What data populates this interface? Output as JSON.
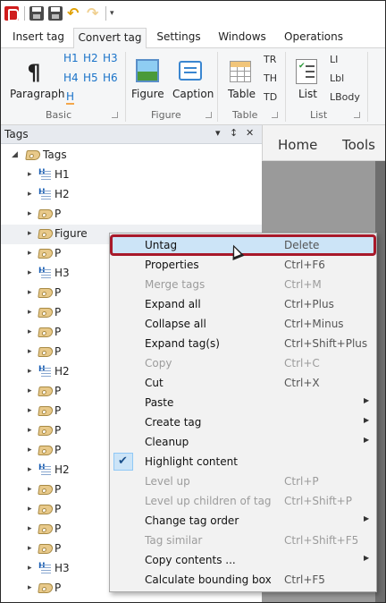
{
  "tabs": [
    "Insert tag",
    "Convert tag",
    "Settings",
    "Windows",
    "Operations"
  ],
  "active_tab": "Convert tag",
  "ribbon": {
    "groups": {
      "basic": "Basic",
      "figure": "Figure",
      "table": "Table",
      "list": "List"
    },
    "paragraph_label": "Paragraph",
    "headings": [
      "H1",
      "H2",
      "H3",
      "H4",
      "H5",
      "H6",
      "H"
    ],
    "figure_label": "Figure",
    "caption_label": "Caption",
    "table_label": "Table",
    "table_small": [
      "TR",
      "TH",
      "TD"
    ],
    "list_label": "List",
    "list_small": [
      "LI",
      "Lbl",
      "LBody"
    ]
  },
  "tags_panel": {
    "title": "Tags",
    "pin": "▾",
    "pin2": "↕",
    "close": "✕",
    "root": "Tags",
    "nodes": [
      {
        "label": "H1",
        "kind": "heading"
      },
      {
        "label": "H2",
        "kind": "heading"
      },
      {
        "label": "P",
        "kind": "tag"
      },
      {
        "label": "Figure",
        "kind": "tag"
      },
      {
        "label": "P",
        "kind": "tag"
      },
      {
        "label": "H3",
        "kind": "heading"
      },
      {
        "label": "P",
        "kind": "tag"
      },
      {
        "label": "P",
        "kind": "tag"
      },
      {
        "label": "P",
        "kind": "tag"
      },
      {
        "label": "P",
        "kind": "tag"
      },
      {
        "label": "H2",
        "kind": "heading"
      },
      {
        "label": "P",
        "kind": "tag"
      },
      {
        "label": "P",
        "kind": "tag"
      },
      {
        "label": "P",
        "kind": "tag"
      },
      {
        "label": "P",
        "kind": "tag"
      },
      {
        "label": "H2",
        "kind": "heading"
      },
      {
        "label": "P",
        "kind": "tag"
      },
      {
        "label": "P",
        "kind": "tag"
      },
      {
        "label": "P",
        "kind": "tag"
      },
      {
        "label": "P",
        "kind": "tag"
      },
      {
        "label": "H3",
        "kind": "heading"
      },
      {
        "label": "P",
        "kind": "tag"
      }
    ]
  },
  "document_tabs": [
    "Home",
    "Tools"
  ],
  "context_menu": [
    {
      "label": "Untag",
      "shortcut": "Delete",
      "state": "highlight"
    },
    {
      "label": "Properties",
      "shortcut": "Ctrl+F6"
    },
    {
      "label": "Merge tags",
      "shortcut": "Ctrl+M",
      "disabled": true
    },
    {
      "label": "Expand all",
      "shortcut": "Ctrl+Plus"
    },
    {
      "label": "Collapse all",
      "shortcut": "Ctrl+Minus"
    },
    {
      "label": "Expand tag(s)",
      "shortcut": "Ctrl+Shift+Plus"
    },
    {
      "label": "Copy",
      "shortcut": "Ctrl+C",
      "disabled": true
    },
    {
      "label": "Cut",
      "shortcut": "Ctrl+X"
    },
    {
      "label": "Paste",
      "shortcut": "",
      "submenu": true
    },
    {
      "label": "Create tag",
      "shortcut": "",
      "submenu": true
    },
    {
      "label": "Cleanup",
      "shortcut": "",
      "submenu": true
    },
    {
      "label": "Highlight content",
      "shortcut": "",
      "checked": true
    },
    {
      "label": "Level up",
      "shortcut": "Ctrl+P",
      "disabled": true
    },
    {
      "label": "Level up children of tag",
      "shortcut": "Ctrl+Shift+P",
      "disabled": true
    },
    {
      "label": "Change tag order",
      "shortcut": "",
      "submenu": true
    },
    {
      "label": "Tag similar",
      "shortcut": "Ctrl+Shift+F5",
      "disabled": true
    },
    {
      "label": "Copy contents ...",
      "shortcut": "",
      "submenu": true
    },
    {
      "label": "Calculate bounding box",
      "shortcut": "Ctrl+F5"
    }
  ],
  "icons": {
    "undo": "↶",
    "redo": "↷",
    "qat_menu": "▾",
    "expand": "▸",
    "expanded": "◢",
    "submenu": "▶",
    "check": "✔",
    "paragraph": "¶"
  },
  "colors": {
    "accent": "#1a73c9",
    "highlight_ring": "#a8192a",
    "menu_hover": "#cce4f7"
  }
}
